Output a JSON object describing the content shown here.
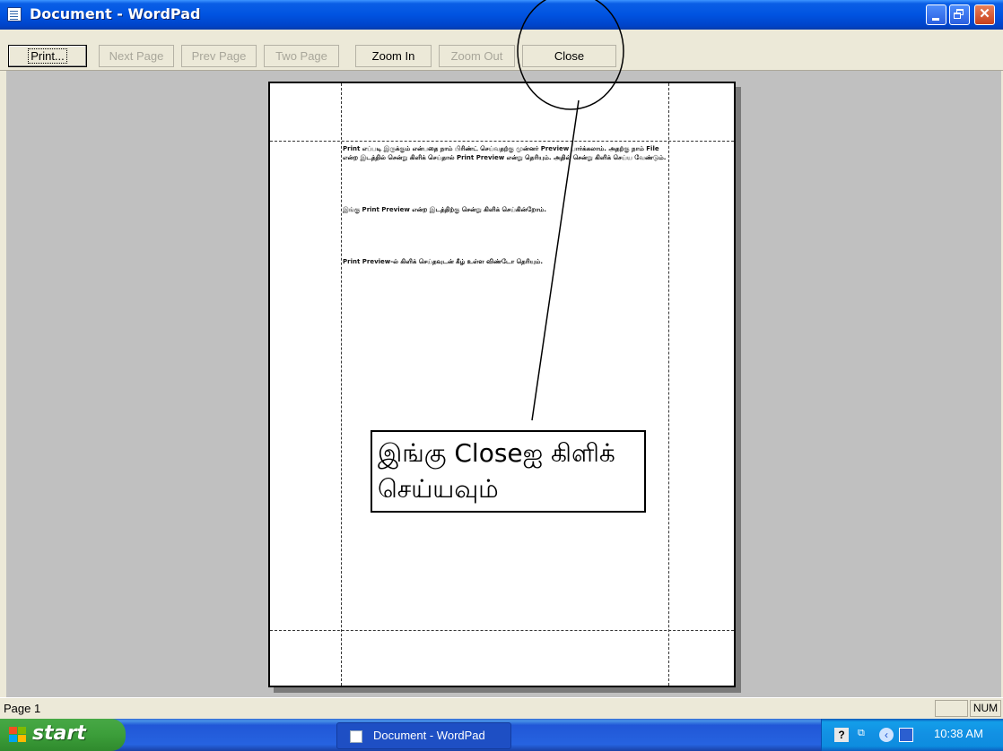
{
  "window": {
    "title": "Document - WordPad"
  },
  "toolbar": {
    "print": "Print...",
    "next_page": "Next Page",
    "prev_page": "Prev Page",
    "two_page": "Two Page",
    "zoom_in": "Zoom In",
    "zoom_out": "Zoom Out",
    "close": "Close"
  },
  "document": {
    "para1": "Print எப்படி இருக்கும் என்பதை நாம் பிரிண்ட் செய்வதற்கு முன்னர் Preview பார்க்கலாம். அதற்கு நாம் File என்ற இடத்தில் சென்று கிளிக் செய்தால் Print Preview என்று தெரியும். அதில் சென்று கிளிக் செய்ய வேண்டும்.",
    "para2": "இங்கு Print Preview என்ற இடத்திற்கு சென்று கிளிக் செய்கின்றோம்.",
    "para3": "Print Preview-ல் கிளிக் செய்தவுடன் கீழ் உள்ள விண்டோ தெரியும்."
  },
  "annotation": {
    "callout_text": "இங்கு Closeஐ கிளிக் செய்யவும்"
  },
  "statusbar": {
    "page": "Page 1",
    "num": "NUM"
  },
  "taskbar": {
    "start": "start",
    "task_item": "Document - WordPad",
    "clock": "10:38 AM"
  }
}
